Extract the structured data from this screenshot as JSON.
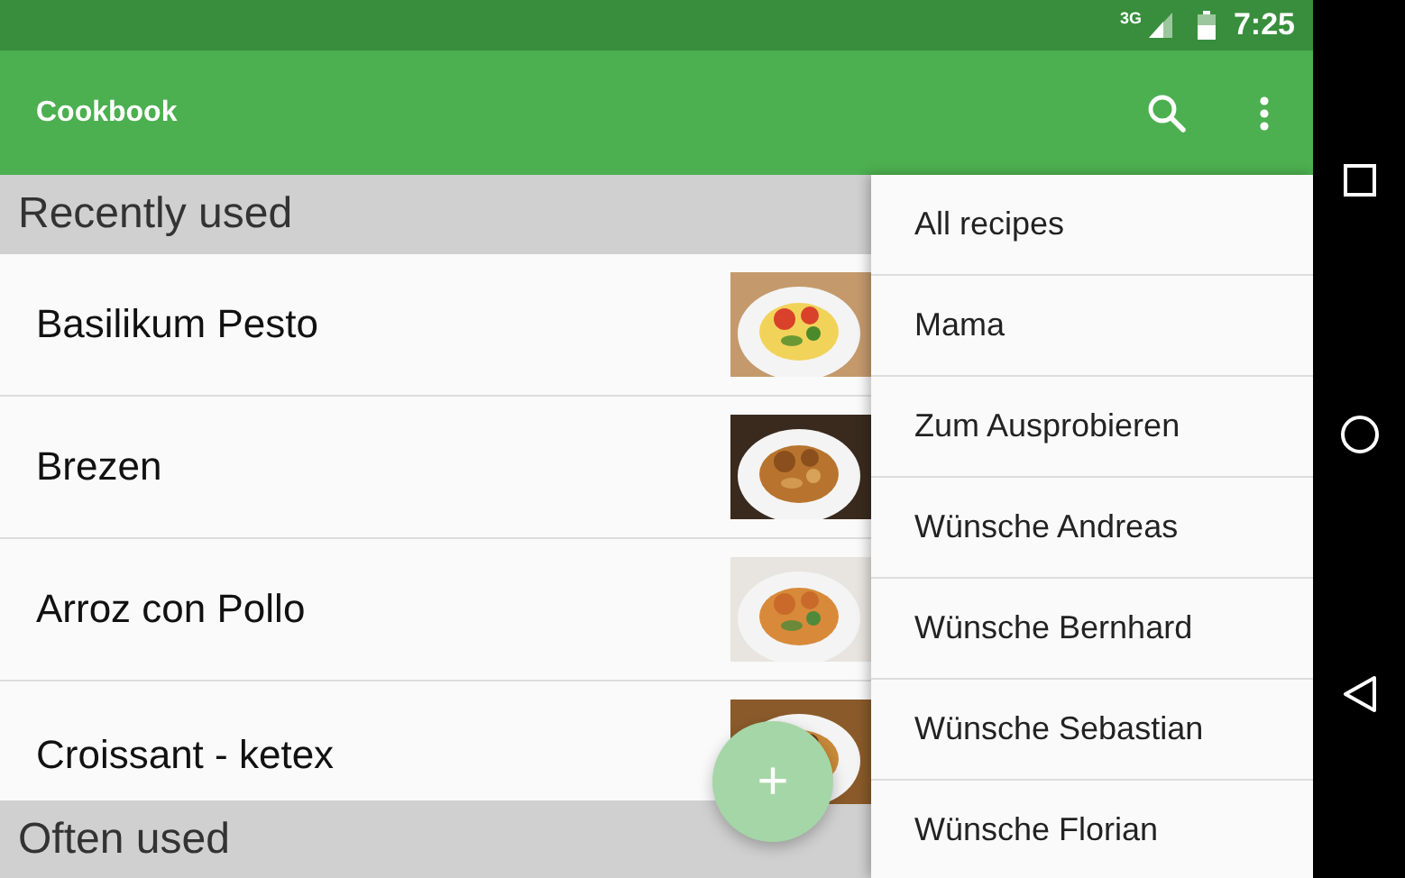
{
  "status_bar": {
    "network": "3G",
    "time": "7:25"
  },
  "app_bar": {
    "title": "Cookbook"
  },
  "list": [
    {
      "kind": "header",
      "title": "Recently used"
    },
    {
      "kind": "recipe",
      "name": "Basilikum Pesto"
    },
    {
      "kind": "recipe",
      "name": "Brezen"
    },
    {
      "kind": "recipe",
      "name": "Arroz con Pollo"
    },
    {
      "kind": "recipe",
      "name": "Croissant - ketex"
    },
    {
      "kind": "header",
      "title": "Often used"
    }
  ],
  "fab": {
    "label": "+"
  },
  "menu": {
    "items": [
      "All recipes",
      "Mama",
      "Zum Ausprobieren",
      "Wünsche Andreas",
      "Wünsche Bernhard",
      "Wünsche Sebastian",
      "Wünsche Florian"
    ]
  }
}
